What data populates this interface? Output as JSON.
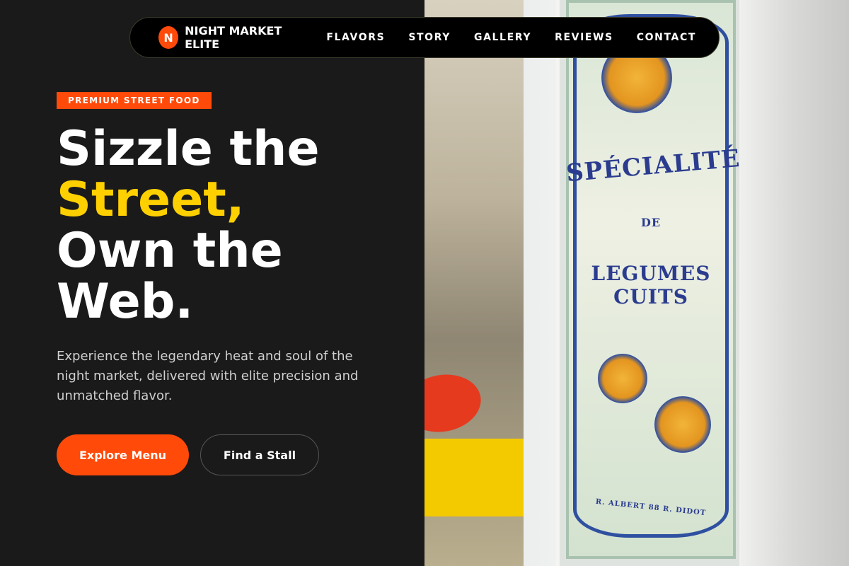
{
  "brand": {
    "logo_letter": "N",
    "name": "NIGHT MARKET ELITE",
    "accent": "#ff4a0a"
  },
  "nav": {
    "items": [
      {
        "label": "FLAVORS"
      },
      {
        "label": "STORY"
      },
      {
        "label": "GALLERY"
      },
      {
        "label": "REVIEWS"
      },
      {
        "label": "CONTACT"
      }
    ]
  },
  "hero": {
    "badge": "PREMIUM STREET FOOD",
    "headline": {
      "line1": "Sizzle the",
      "line2_accent": "Street,",
      "line3": "Own the",
      "line4": "Web."
    },
    "subtitle": "Experience the legendary heat and soul of the night market, delivered with elite precision and unmatched flavor.",
    "primary_cta": "Explore Menu",
    "secondary_cta": "Find a Stall",
    "highlight_color": "#ffd000"
  },
  "photo": {
    "sign_line1": "SPÉCIALITÉ",
    "sign_line2": "DE",
    "sign_line3": "LEGUMES CUITS",
    "sign_maker": "R. ALBERT 88 R. DIDOT"
  }
}
